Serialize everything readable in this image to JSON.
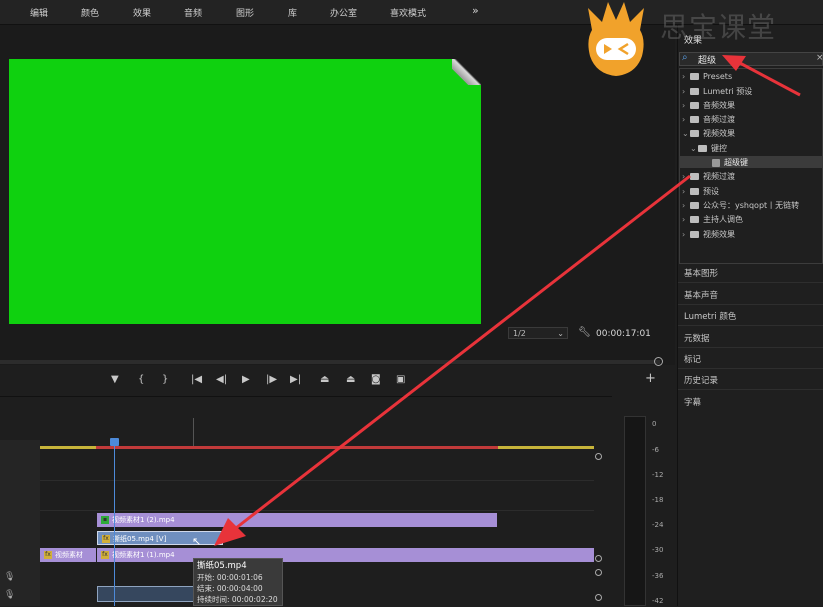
{
  "menu": [
    "编辑",
    "颜色",
    "效果",
    "音频",
    "图形",
    "库",
    "办公室",
    "喜欢模式",
    "»"
  ],
  "monitor": {
    "resolution": "1/2",
    "timecode": "00:00:17:01",
    "transport_icons": [
      "marker-icon",
      "mark-in-icon",
      "mark-out-icon",
      "go-to-in-icon",
      "step-back-icon",
      "play-icon",
      "step-forward-icon",
      "go-to-out-icon",
      "lift-icon",
      "extract-icon",
      "export-frame-icon",
      "comparison-icon",
      "add-icon"
    ]
  },
  "timeline": {
    "clips": {
      "v3": "视频素材1 (2).mp4",
      "v2": "撕纸05.mp4 [V]",
      "v1a": "视频素材",
      "v1b": "视频素材1 (1).mp4"
    },
    "tooltip": {
      "name": "撕纸05.mp4",
      "start": "开始: 00:00:01:06",
      "end": "结束: 00:00:04:00",
      "duration": "持续时间: 00:00:02:20"
    },
    "meter_db": [
      "0",
      "-6",
      "-12",
      "-18",
      "-24",
      "-30",
      "-36",
      "-42"
    ]
  },
  "effects_panel": {
    "title": "效果",
    "search_value": "超级",
    "tree": [
      {
        "label": "Presets",
        "level": 0,
        "open": false
      },
      {
        "label": "Lumetri 预设",
        "level": 0,
        "open": false
      },
      {
        "label": "音频效果",
        "level": 0,
        "open": false
      },
      {
        "label": "音频过渡",
        "level": 0,
        "open": false
      },
      {
        "label": "视频效果",
        "level": 0,
        "open": true
      },
      {
        "label": "键控",
        "level": 1,
        "open": true
      },
      {
        "label": "超级键",
        "level": 2,
        "open": false
      },
      {
        "label": "视频过渡",
        "level": 0,
        "open": false
      },
      {
        "label": "预设",
        "level": 0,
        "open": false
      },
      {
        "label": "公众号：yshqopt丨无链转",
        "level": 0,
        "open": false
      },
      {
        "label": "主持人调色",
        "level": 0,
        "open": false
      },
      {
        "label": "视频效果",
        "level": 0,
        "open": false
      }
    ],
    "sections": [
      "基本图形",
      "基本声音",
      "Lumetri 颜色",
      "元数据",
      "标记",
      "历史记录",
      "字幕"
    ]
  },
  "watermark": {
    "text": "思宝课堂"
  },
  "colors": {
    "green_screen": "#0fd10f",
    "accent_red": "#e8333a",
    "clip_purple": "#a68fd6",
    "clip_blue": "#6f8fbf"
  }
}
